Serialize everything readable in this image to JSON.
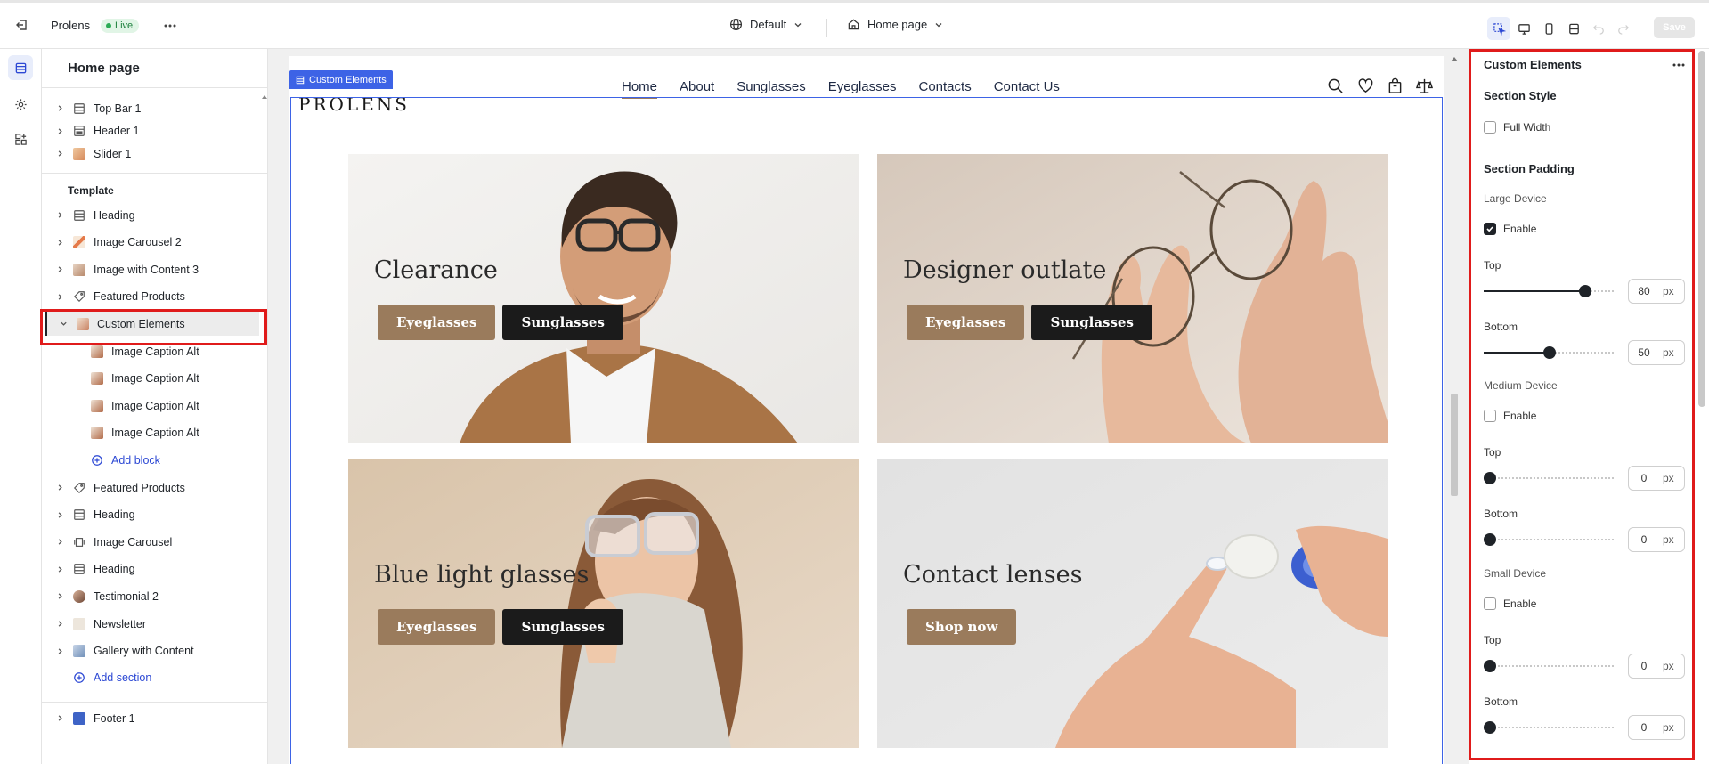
{
  "topbar": {
    "site_name": "Prolens",
    "status": "Live",
    "language": "Default",
    "page_selector": "Home page",
    "save_label": "Save"
  },
  "structure": {
    "title": "Home page",
    "header_items": [
      {
        "label": "Top Bar 1",
        "icon": "section-icon"
      },
      {
        "label": "Header 1",
        "icon": "header-icon"
      },
      {
        "label": "Slider 1",
        "icon": "slider-thumb-icon"
      }
    ],
    "template_label": "Template",
    "template_items": [
      {
        "label": "Heading",
        "icon": "section-icon"
      },
      {
        "label": "Image Carousel 2",
        "icon": "carousel-thumb-icon"
      },
      {
        "label": "Image with Content 3",
        "icon": "image-content-thumb-icon"
      },
      {
        "label": "Featured Products",
        "icon": "tag-icon"
      },
      {
        "label": "Custom Elements",
        "icon": "custom-thumb-icon",
        "selected": true
      },
      {
        "label": "Image Caption Alt",
        "icon": "caption-thumb-icon",
        "child": true
      },
      {
        "label": "Image Caption Alt",
        "icon": "caption-thumb-icon",
        "child": true
      },
      {
        "label": "Image Caption Alt",
        "icon": "caption-thumb-icon",
        "child": true
      },
      {
        "label": "Image Caption Alt",
        "icon": "caption-thumb-icon",
        "child": true
      },
      {
        "label": "Add block",
        "icon": "plus-circle-icon",
        "child": true,
        "link": true
      },
      {
        "label": "Featured Products",
        "icon": "tag-icon"
      },
      {
        "label": "Heading",
        "icon": "section-icon"
      },
      {
        "label": "Image Carousel",
        "icon": "carousel-icon"
      },
      {
        "label": "Heading",
        "icon": "section-icon"
      },
      {
        "label": "Testimonial 2",
        "icon": "testimonial-thumb-icon"
      },
      {
        "label": "Newsletter",
        "icon": "newsletter-thumb-icon"
      },
      {
        "label": "Gallery with Content",
        "icon": "gallery-thumb-icon"
      }
    ],
    "add_section": "Add section",
    "footer_items": [
      {
        "label": "Footer 1",
        "icon": "footer-thumb-icon"
      }
    ]
  },
  "canvas": {
    "section_tag": "Custom Elements",
    "logo": "PROLENS",
    "nav": [
      "Home",
      "About",
      "Sunglasses",
      "Eyeglasses",
      "Contacts",
      "Contact Us"
    ],
    "cards": [
      {
        "title": "Clearance",
        "buttons": [
          "Eyeglasses",
          "Sunglasses"
        ]
      },
      {
        "title": "Designer outlate",
        "buttons": [
          "Eyeglasses",
          "Sunglasses"
        ]
      },
      {
        "title": "Blue light glasses",
        "buttons": [
          "Eyeglasses",
          "Sunglasses"
        ]
      },
      {
        "title": "Contact lenses",
        "buttons": [
          "Shop now"
        ]
      }
    ]
  },
  "settings": {
    "title": "Custom Elements",
    "section_style": "Section Style",
    "full_width": "Full Width",
    "full_width_checked": false,
    "section_padding": "Section Padding",
    "unit": "px",
    "devices": [
      {
        "name": "Large Device",
        "enable": "Enable",
        "enabled": true,
        "top_label": "Top",
        "top": "80",
        "bottom_label": "Bottom",
        "bottom": "50",
        "top_fraction": 0.8,
        "bottom_fraction": 0.5
      },
      {
        "name": "Medium Device",
        "enable": "Enable",
        "enabled": false,
        "top_label": "Top",
        "top": "0",
        "bottom_label": "Bottom",
        "bottom": "0",
        "top_fraction": 0,
        "bottom_fraction": 0
      },
      {
        "name": "Small Device",
        "enable": "Enable",
        "enabled": false,
        "top_label": "Top",
        "top": "0",
        "bottom_label": "Bottom",
        "bottom": "0",
        "top_fraction": 0,
        "bottom_fraction": 0
      }
    ]
  },
  "colors": {
    "accent": "#3d63e6",
    "highlight_box": "#e01b1b",
    "brand_button": "#9a7b5c",
    "dark_button": "#1b1b1b"
  }
}
